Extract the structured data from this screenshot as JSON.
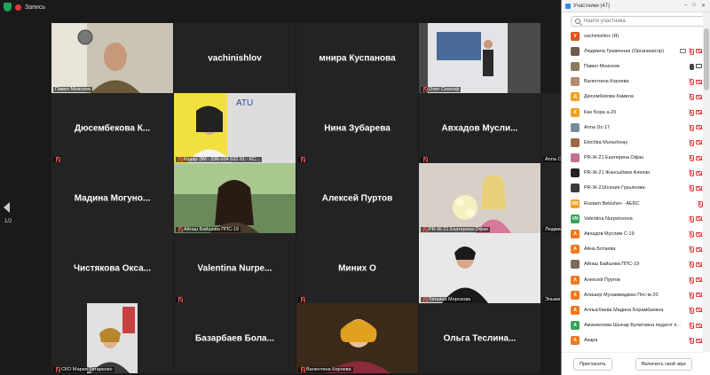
{
  "topbar": {
    "record_label": "Запись"
  },
  "pager": {
    "page": "1/2"
  },
  "tiles": [
    {
      "name": "",
      "label": "Павел Моисеев",
      "kind": "video",
      "col": 0,
      "row": 0,
      "selected": true,
      "muted": false
    },
    {
      "name": "vachinishlov",
      "label": "",
      "kind": "name",
      "col": 1,
      "row": 0,
      "muted": false
    },
    {
      "name": "мнира Куспанова",
      "label": "",
      "kind": "name",
      "col": 2,
      "row": 0,
      "muted": false
    },
    {
      "name": "",
      "label": "Олег Сиахоф",
      "kind": "video",
      "col": 3,
      "row": 0,
      "muted": true
    },
    {
      "name": "Дюсембекова  К...",
      "label": "",
      "kind": "name",
      "col": 0,
      "row": 1,
      "muted": true
    },
    {
      "name": "",
      "label": "Кодар ЭМ - 336-104 632 б1 - КС...",
      "kind": "video",
      "col": 1,
      "row": 1,
      "muted": true
    },
    {
      "name": "Нина Зубарева",
      "label": "",
      "kind": "name",
      "col": 2,
      "row": 1,
      "muted": true
    },
    {
      "name": "Авхадов  Мусли...",
      "label": "",
      "kind": "name",
      "col": 3,
      "row": 1,
      "muted": true
    },
    {
      "name": "Мадина  Могуно...",
      "label": "",
      "kind": "name",
      "col": 0,
      "row": 2,
      "muted": false
    },
    {
      "name": "",
      "label": "Айгаш Байшова ППС-19",
      "kind": "video",
      "col": 1,
      "row": 2,
      "muted": true
    },
    {
      "name": "Алексей Пуртов",
      "label": "",
      "kind": "name",
      "col": 2,
      "row": 2,
      "muted": false
    },
    {
      "name": "",
      "label": "PR-Ж-21 Екатерина Офан",
      "kind": "video",
      "col": 3,
      "row": 2,
      "muted": true
    },
    {
      "name": "Чистякова  Окса...",
      "label": "",
      "kind": "name",
      "col": 0,
      "row": 3,
      "muted": false
    },
    {
      "name": "Valentina  Nurpe...",
      "label": "",
      "kind": "name",
      "col": 1,
      "row": 3,
      "muted": true
    },
    {
      "name": "Миних О",
      "label": "",
      "kind": "name",
      "col": 2,
      "row": 3,
      "muted": true
    },
    {
      "name": "",
      "label": "Татьяна Морозова",
      "kind": "video",
      "col": 3,
      "row": 3,
      "muted": true
    },
    {
      "name": "",
      "label": "СКО Мария Татаренко",
      "kind": "video",
      "col": 0,
      "row": 4,
      "muted": true
    },
    {
      "name": "Базарбаев  Бола...",
      "label": "",
      "kind": "name",
      "col": 1,
      "row": 4,
      "muted": false
    },
    {
      "name": "",
      "label": "Валентина Корнева",
      "kind": "video",
      "col": 2,
      "row": 4,
      "muted": true
    },
    {
      "name": "Ольга  Теслина...",
      "label": "",
      "kind": "name",
      "col": 3,
      "row": 4,
      "muted": false
    }
  ],
  "edge_labels": [
    "Anna C",
    "Людмил",
    "Эльвин"
  ],
  "panel": {
    "title": "Участники (47)",
    "search_placeholder": "Найти участника",
    "invite_label": "Пригласить",
    "unmute_label": "Включить свой звук",
    "participants": [
      {
        "name": "vachinishlov (Я)",
        "avatar": "V",
        "color": "#e0541b",
        "mic": "none",
        "cam": "none"
      },
      {
        "name": "Людмила Гревенная (Организатор)",
        "avatar": "",
        "color": "#6b5b4b",
        "mic": "off",
        "cam": "off",
        "extra": "video"
      },
      {
        "name": "Павел Моисеев",
        "avatar": "",
        "color": "#8a7a5e",
        "mic": "on",
        "cam": "on"
      },
      {
        "name": "Валентина Корнева",
        "avatar": "",
        "color": "#b58a6a",
        "mic": "off",
        "cam": "off"
      },
      {
        "name": "Дюсембекова Камила",
        "avatar": "Д",
        "color": "#f0a020",
        "mic": "off",
        "cam": "off"
      },
      {
        "name": "Кан Бора а-20",
        "avatar": "К",
        "color": "#f0a020",
        "mic": "off",
        "cam": "off"
      },
      {
        "name": "Anna Dz-17",
        "avatar": "",
        "color": "#7a8a9a",
        "mic": "off",
        "cam": "off"
      },
      {
        "name": "Elochka Muravlovay",
        "avatar": "",
        "color": "#9a6a4a",
        "mic": "off",
        "cam": "off"
      },
      {
        "name": "PR-Ж-21 Екатерина Офан",
        "avatar": "",
        "color": "#c07090",
        "mic": "off",
        "cam": "off"
      },
      {
        "name": "PR-Ж-21 Жансыбаев Алихан",
        "avatar": "",
        "color": "#222222",
        "mic": "off",
        "cam": "off"
      },
      {
        "name": "PR-Ж-21Ксения Гурьянова-",
        "avatar": "",
        "color": "#3a3a3a",
        "mic": "off",
        "cam": "off"
      },
      {
        "name": "Rustam Bekishev - AERC",
        "avatar": "RB",
        "color": "#f0a020",
        "mic": "off",
        "cam": "none"
      },
      {
        "name": "Valentina Nurpeissova",
        "avatar": "VN",
        "color": "#3aa05a",
        "mic": "off",
        "cam": "off"
      },
      {
        "name": "Авхадов Муслим С-19",
        "avatar": "А",
        "color": "#f07820",
        "mic": "off",
        "cam": "off"
      },
      {
        "name": "Айна Ботаева",
        "avatar": "А",
        "color": "#f07820",
        "mic": "off",
        "cam": "off"
      },
      {
        "name": "Айгаш Байшова ППС-19",
        "avatar": "",
        "color": "#7a6a5a",
        "mic": "off",
        "cam": "off"
      },
      {
        "name": "Алексей Пуртов",
        "avatar": "А",
        "color": "#f07820",
        "mic": "off",
        "cam": "off"
      },
      {
        "name": "Алишер Мухаммаджан Ппс-м-20",
        "avatar": "А",
        "color": "#f07820",
        "mic": "off",
        "cam": "off"
      },
      {
        "name": "Алпысбаева Мадина Борамбаевна",
        "avatar": "А",
        "color": "#f07820",
        "mic": "off",
        "cam": "off"
      },
      {
        "name": "Аманкелова Шынар Булатовна педагог п...",
        "avatar": "А",
        "color": "#3aa05a",
        "mic": "off",
        "cam": "off"
      },
      {
        "name": "Акара",
        "avatar": "А",
        "color": "#f07820",
        "mic": "off",
        "cam": "off"
      }
    ]
  }
}
